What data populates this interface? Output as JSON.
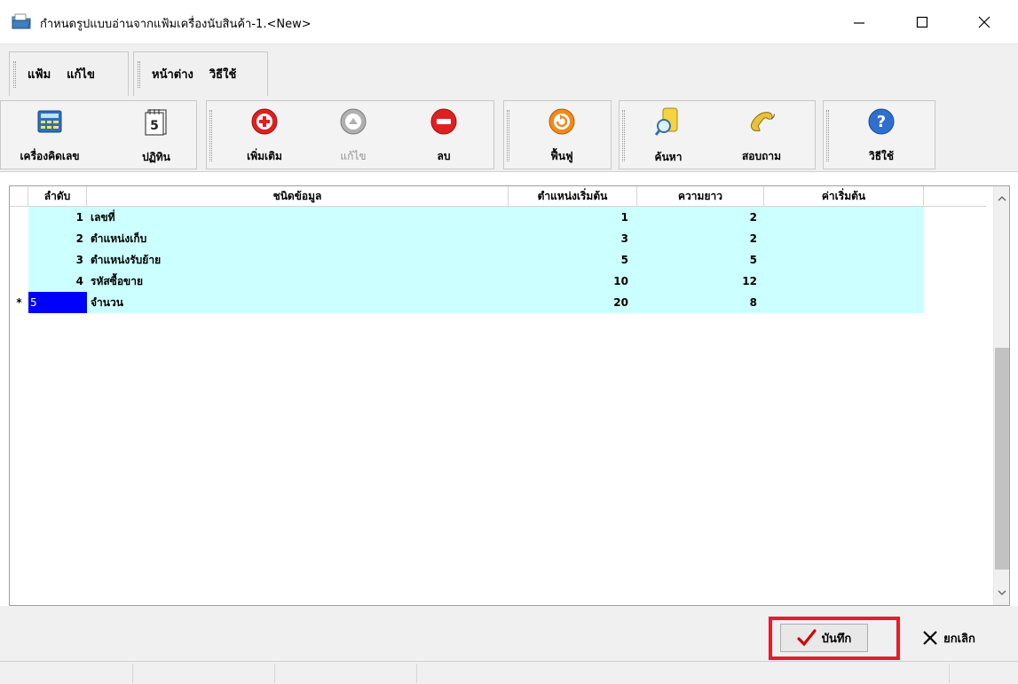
{
  "window": {
    "title": "กำหนดรูปแบบอ่านจากแฟ้มเครื่องนับสินค้า-1.<New>",
    "icon": "app-folder-icon"
  },
  "menu": {
    "group1": [
      "แฟ้ม",
      "แก้ไข"
    ],
    "group2": [
      "หน้าต่าง",
      "วิธีใช้"
    ]
  },
  "toolbar": {
    "calculator": "เครื่องคิดเลข",
    "calendar": "ปฏิทิน",
    "add": "เพิ่มเติม",
    "edit": "แก้ไข",
    "delete": "ลบ",
    "restore": "ฟื้นฟู",
    "search": "ค้นหา",
    "inquiry": "สอบถาม",
    "help": "วิธีใช้"
  },
  "grid": {
    "headers": {
      "no": "ลำดับ",
      "type": "ชนิดข้อมูล",
      "start": "ตำแหน่งเริ่มต้น",
      "length": "ความยาว",
      "default": "ค่าเริ่มต้น"
    },
    "rows": [
      {
        "indicator": "",
        "no": "1",
        "type": "เลขที่",
        "start": "1",
        "length": "2",
        "default": ""
      },
      {
        "indicator": "",
        "no": "2",
        "type": "ตำแหน่งเก็บ",
        "start": "3",
        "length": "2",
        "default": ""
      },
      {
        "indicator": "",
        "no": "3",
        "type": "ตำแหน่งรับย้าย",
        "start": "5",
        "length": "5",
        "default": ""
      },
      {
        "indicator": "",
        "no": "4",
        "type": "รหัสซื้อขาย",
        "start": "10",
        "length": "12",
        "default": ""
      },
      {
        "indicator": "*",
        "no": "5",
        "type": "จำนวน",
        "start": "20",
        "length": "8",
        "default": ""
      }
    ]
  },
  "buttons": {
    "save": "บันทึก",
    "cancel": "ยกเลิก"
  },
  "colors": {
    "row_bg": "#ccffff",
    "selected_cell": "#0000ff",
    "highlight": "#e0202a"
  }
}
